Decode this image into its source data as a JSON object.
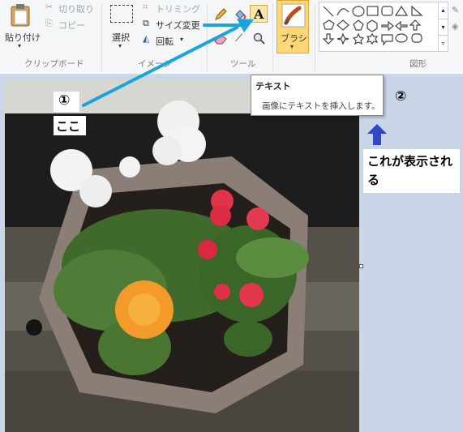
{
  "ribbon": {
    "clipboard": {
      "paste_label": "貼り付け",
      "cut_label": "切り取り",
      "copy_label": "コピー",
      "group_label": "クリップボード"
    },
    "image": {
      "select_label": "選択",
      "crop_label": "トリミング",
      "resize_label": "サイズ変更",
      "rotate_label": "回転",
      "group_label": "イメージ"
    },
    "tools": {
      "group_label": "ツール",
      "text_tool_glyph": "A"
    },
    "brush": {
      "label": "ブラシ"
    },
    "shapes": {
      "group_label": "図形"
    }
  },
  "tooltip": {
    "title": "テキスト",
    "description": "画像にテキストを挿入します。"
  },
  "annotations": {
    "step1_number": "①",
    "step1_text": "ここ",
    "step2_number": "②",
    "step2_text": "これが表示される"
  },
  "colors": {
    "arrow": "#1aa3dc",
    "up_arrow": "#3346c8",
    "brush_highlight": "#ffd774"
  }
}
